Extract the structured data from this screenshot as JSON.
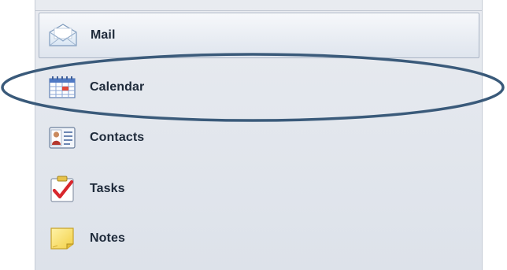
{
  "navigation": {
    "items": [
      {
        "label": "Mail",
        "icon": "mail-icon",
        "selected": true
      },
      {
        "label": "Calendar",
        "icon": "calendar-icon",
        "selected": false
      },
      {
        "label": "Contacts",
        "icon": "contacts-icon",
        "selected": false
      },
      {
        "label": "Tasks",
        "icon": "tasks-icon",
        "selected": false
      },
      {
        "label": "Notes",
        "icon": "notes-icon",
        "selected": false
      }
    ]
  },
  "annotation": {
    "highlight_target": "Calendar",
    "shape": "ellipse",
    "color": "#3a5a7a"
  },
  "colors": {
    "pane_background": "#e3e7ee",
    "selected_item_background": "#eef1f6",
    "label_text": "#1e2a3a"
  }
}
